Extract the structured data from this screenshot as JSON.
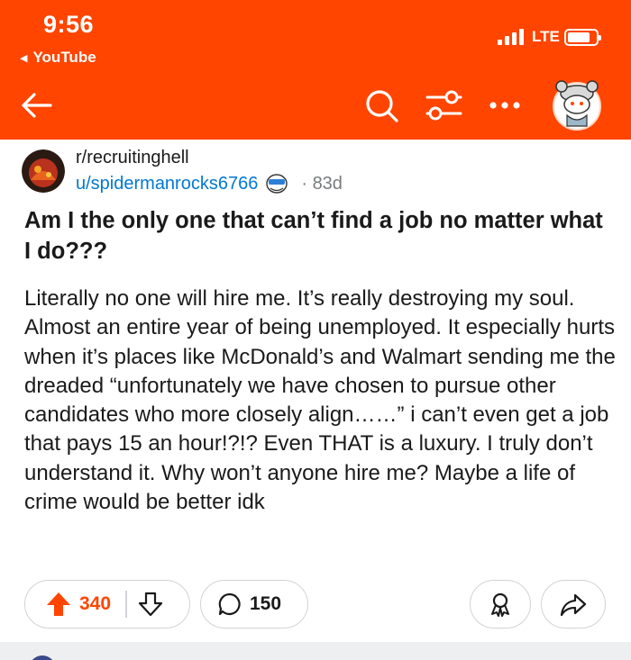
{
  "status_bar": {
    "time": "9:56",
    "back_app_label": "YouTube",
    "network": "LTE"
  },
  "header": {
    "back_icon": "arrow-left-icon",
    "search_icon": "search-icon",
    "filter_icon": "filter-icon",
    "more_icon": "more-dots-icon",
    "avatar_icon": "user-avatar-icon"
  },
  "post": {
    "subreddit": "r/recruitinghell",
    "author": "u/spidermanrocks6766",
    "age": "83d",
    "title": "Am I the only one that can’t find a job no matter what I do???",
    "body": "Literally no one will hire me. It’s really destroying my soul. Almost an entire year of being unemployed. It especially hurts when it’s places like McDonald’s and Walmart sending me the dreaded “unfortunately we have chosen to pursue other candidates who more closely align……” i can’t even get a job that pays 15 an hour!?!? Even THAT is a luxury. I truly don’t understand it. Why won’t anyone hire me? Maybe a life of crime would be better idk"
  },
  "actions": {
    "score": "340",
    "comments": "150"
  },
  "colors": {
    "brand": "#ff4500",
    "link": "#0079d3",
    "text": "#1a1a1b",
    "muted": "#787c7e"
  }
}
